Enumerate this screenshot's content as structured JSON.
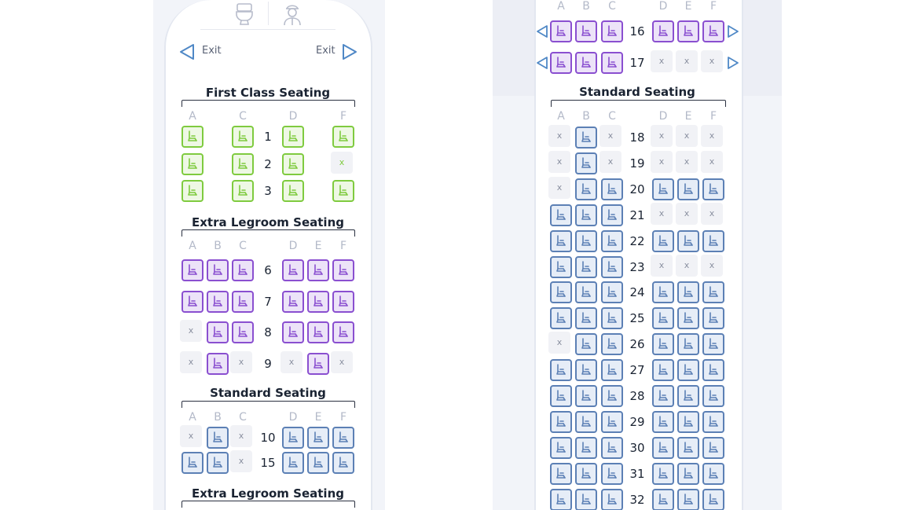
{
  "left": {
    "exit_left_label": "Exit",
    "exit_right_label": "Exit",
    "sections": [
      {
        "title": "First Class Seating",
        "class": "first",
        "columns": [
          "A",
          "",
          "C",
          "D",
          "",
          "F"
        ],
        "rows": [
          {
            "num": "1",
            "seats": [
              "A",
              null,
              "A",
              "A",
              null,
              "A"
            ]
          },
          {
            "num": "2",
            "seats": [
              "A",
              null,
              "A",
              "A",
              null,
              "X"
            ]
          },
          {
            "num": "3",
            "seats": [
              "A",
              null,
              "A",
              "A",
              null,
              "A"
            ]
          }
        ]
      },
      {
        "title": "Extra Legroom Seating",
        "class": "legroom",
        "columns": [
          "A",
          "B",
          "C",
          "D",
          "E",
          "F"
        ],
        "rows": [
          {
            "num": "6",
            "seats": [
              "A",
              "A",
              "A",
              "A",
              "A",
              "A"
            ]
          },
          {
            "num": "7",
            "seats": [
              "A",
              "A",
              "A",
              "A",
              "A",
              "A"
            ]
          },
          {
            "num": "8",
            "seats": [
              "X",
              "A",
              "A",
              "A",
              "A",
              "A"
            ]
          },
          {
            "num": "9",
            "seats": [
              "X",
              "A",
              "X",
              "X",
              "A",
              "X"
            ]
          }
        ]
      },
      {
        "title": "Standard Seating",
        "class": "std",
        "columns": [
          "A",
          "B",
          "C",
          "D",
          "E",
          "F"
        ],
        "rows": [
          {
            "num": "10",
            "seats": [
              "X",
              "A",
              "X",
              "A",
              "A",
              "A"
            ]
          },
          {
            "num": "15",
            "seats": [
              "A",
              "A",
              "X",
              "A",
              "A",
              "A"
            ]
          }
        ]
      },
      {
        "title": "Extra Legroom Seating",
        "class": "legroom",
        "columns": [],
        "rows": []
      }
    ],
    "unavailable_mark": "x"
  },
  "right": {
    "top_columns": [
      "A",
      "B",
      "C",
      "D",
      "E",
      "F"
    ],
    "legroom_rows": [
      {
        "num": "16",
        "seats": [
          "A",
          "A",
          "A",
          "A",
          "A",
          "A"
        ],
        "exit": true
      },
      {
        "num": "17",
        "seats": [
          "A",
          "A",
          "A",
          "X",
          "X",
          "X"
        ],
        "exit": true
      }
    ],
    "standard_title": "Standard Seating",
    "standard_columns": [
      "A",
      "B",
      "C",
      "D",
      "E",
      "F"
    ],
    "standard_rows": [
      {
        "num": "18",
        "seats": [
          "X",
          "A",
          "X",
          "X",
          "X",
          "X"
        ]
      },
      {
        "num": "19",
        "seats": [
          "X",
          "A",
          "X",
          "X",
          "X",
          "X"
        ]
      },
      {
        "num": "20",
        "seats": [
          "X",
          "A",
          "A",
          "A",
          "A",
          "A"
        ]
      },
      {
        "num": "21",
        "seats": [
          "A",
          "A",
          "A",
          "X",
          "X",
          "X"
        ]
      },
      {
        "num": "22",
        "seats": [
          "A",
          "A",
          "A",
          "A",
          "A",
          "A"
        ]
      },
      {
        "num": "23",
        "seats": [
          "A",
          "A",
          "A",
          "X",
          "X",
          "X"
        ]
      },
      {
        "num": "24",
        "seats": [
          "A",
          "A",
          "A",
          "A",
          "A",
          "A"
        ]
      },
      {
        "num": "25",
        "seats": [
          "A",
          "A",
          "A",
          "A",
          "A",
          "A"
        ]
      },
      {
        "num": "26",
        "seats": [
          "X",
          "A",
          "A",
          "A",
          "A",
          "A"
        ]
      },
      {
        "num": "27",
        "seats": [
          "A",
          "A",
          "A",
          "A",
          "A",
          "A"
        ]
      },
      {
        "num": "28",
        "seats": [
          "A",
          "A",
          "A",
          "A",
          "A",
          "A"
        ]
      },
      {
        "num": "29",
        "seats": [
          "A",
          "A",
          "A",
          "A",
          "A",
          "A"
        ]
      },
      {
        "num": "30",
        "seats": [
          "A",
          "A",
          "A",
          "A",
          "A",
          "A"
        ]
      },
      {
        "num": "31",
        "seats": [
          "A",
          "A",
          "A",
          "A",
          "A",
          "A"
        ]
      },
      {
        "num": "32",
        "seats": [
          "A",
          "A",
          "A",
          "A",
          "A",
          "A"
        ]
      }
    ]
  },
  "icons": {
    "lavatory": "toilet-icon",
    "galley": "flight-attendant-icon",
    "exit_arrow": "exit-arrow-icon",
    "seat": "seat-icon"
  },
  "colors": {
    "first_class": "#7fcb3f",
    "extra_legroom": "#8a4fd0",
    "standard": "#5c80b5",
    "exit_arrow": "#4f88c6"
  }
}
